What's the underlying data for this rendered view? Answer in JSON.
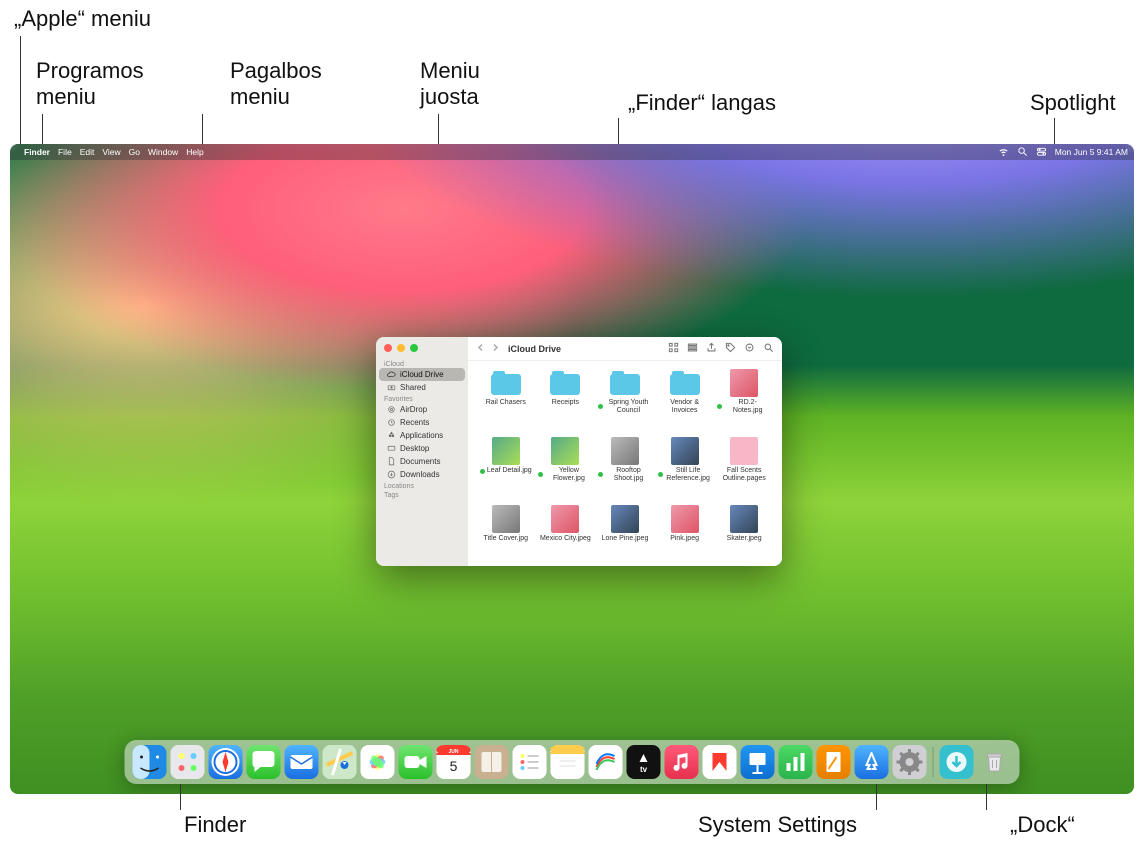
{
  "callouts": {
    "apple_menu": "„Apple“ meniu",
    "app_menu": "Programos\nmeniu",
    "help_menu": "Pagalbos\nmeniu",
    "menu_bar": "Meniu\njuosta",
    "finder_window": "„Finder“ langas",
    "spotlight": "Spotlight",
    "finder_dock": "Finder",
    "system_settings": "System Settings",
    "dock": "„Dock“"
  },
  "menubar": {
    "apple": "",
    "app": "Finder",
    "items": [
      "File",
      "Edit",
      "View",
      "Go",
      "Window",
      "Help"
    ],
    "datetime": "Mon Jun 5  9:41 AM"
  },
  "finder": {
    "title": "iCloud Drive",
    "sidebar": {
      "groups": [
        {
          "label": "iCloud",
          "items": [
            {
              "icon": "cloud",
              "label": "iCloud Drive",
              "selected": true
            },
            {
              "icon": "shared",
              "label": "Shared"
            }
          ]
        },
        {
          "label": "Favorites",
          "items": [
            {
              "icon": "airdrop",
              "label": "AirDrop"
            },
            {
              "icon": "clock",
              "label": "Recents"
            },
            {
              "icon": "apps",
              "label": "Applications"
            },
            {
              "icon": "desktop",
              "label": "Desktop"
            },
            {
              "icon": "doc",
              "label": "Documents"
            },
            {
              "icon": "down",
              "label": "Downloads"
            }
          ]
        },
        {
          "label": "Locations",
          "items": []
        },
        {
          "label": "Tags",
          "items": []
        }
      ]
    },
    "items": [
      {
        "type": "folder",
        "label": "Rail Chasers"
      },
      {
        "type": "folder",
        "label": "Receipts"
      },
      {
        "type": "folder",
        "label": "Spring Youth Council",
        "dot": true
      },
      {
        "type": "folder",
        "label": "Vendor & Invoices"
      },
      {
        "type": "img",
        "v": "c",
        "label": "RD.2-Notes.jpg",
        "dot": true
      },
      {
        "type": "img",
        "v": "b",
        "label": "Leaf Detail.jpg",
        "dot": true
      },
      {
        "type": "img",
        "v": "b",
        "label": "Yellow Flower.jpg",
        "dot": true
      },
      {
        "type": "img",
        "v": "d",
        "label": "Rooftop Shoot.jpg",
        "dot": true
      },
      {
        "type": "img",
        "v": "f",
        "label": "Still Life Reference.jpg",
        "dot": true
      },
      {
        "type": "img",
        "v": "e",
        "label": "Fall Scents Outline.pages"
      },
      {
        "type": "img",
        "v": "d",
        "label": "Title Cover.jpg"
      },
      {
        "type": "img",
        "v": "c",
        "label": "Mexico City.jpeg"
      },
      {
        "type": "img",
        "v": "f",
        "label": "Lone Pine.jpeg"
      },
      {
        "type": "img",
        "v": "c",
        "label": "Pink.jpeg"
      },
      {
        "type": "img",
        "v": "f",
        "label": "Skater.jpeg"
      }
    ]
  },
  "dock": {
    "apps": [
      {
        "name": "Finder",
        "bg": "linear-gradient(#46c3ff,#1e8ae6)",
        "icon": "finder"
      },
      {
        "name": "Launchpad",
        "bg": "#e8e8ec",
        "icon": "grid"
      },
      {
        "name": "Safari",
        "bg": "linear-gradient(#4fb4ff,#1a6fe0)",
        "icon": "compass"
      },
      {
        "name": "Messages",
        "bg": "linear-gradient(#6fe56f,#2bc02b)",
        "icon": "bubble"
      },
      {
        "name": "Mail",
        "bg": "linear-gradient(#4fb4ff,#1a6fe0)",
        "icon": "mail"
      },
      {
        "name": "Maps",
        "bg": "linear-gradient(#a8e6a8,#f5f5f0)",
        "icon": "map"
      },
      {
        "name": "Photos",
        "bg": "#fff",
        "icon": "flower"
      },
      {
        "name": "FaceTime",
        "bg": "linear-gradient(#6fe56f,#2bc02b)",
        "icon": "video"
      },
      {
        "name": "Calendar",
        "bg": "#fff",
        "icon": "cal"
      },
      {
        "name": "Contacts",
        "bg": "#c8b090",
        "icon": "book"
      },
      {
        "name": "Reminders",
        "bg": "#fff",
        "icon": "list"
      },
      {
        "name": "Notes",
        "bg": "#fff",
        "icon": "note"
      },
      {
        "name": "Freeform",
        "bg": "#fff",
        "icon": "free"
      },
      {
        "name": "TV",
        "bg": "#111",
        "icon": "tv"
      },
      {
        "name": "Music",
        "bg": "linear-gradient(#ff5a78,#e6304e)",
        "icon": "music"
      },
      {
        "name": "News",
        "bg": "#fff",
        "icon": "news"
      },
      {
        "name": "Keynote",
        "bg": "linear-gradient(#2196f3,#0d6fd1)",
        "icon": "keynote"
      },
      {
        "name": "Numbers",
        "bg": "linear-gradient(#4cd964,#28b44a)",
        "icon": "numbers"
      },
      {
        "name": "Pages",
        "bg": "linear-gradient(#ff9500,#e67e00)",
        "icon": "pages"
      },
      {
        "name": "App Store",
        "bg": "linear-gradient(#4fb4ff,#1a6fe0)",
        "icon": "astore"
      },
      {
        "name": "System Settings",
        "bg": "#d0d0d4",
        "icon": "gear"
      }
    ],
    "right": [
      {
        "name": "Downloads",
        "bg": "#35c0d0",
        "icon": "down"
      }
    ],
    "cal_month": "JUN",
    "cal_day": "5"
  }
}
